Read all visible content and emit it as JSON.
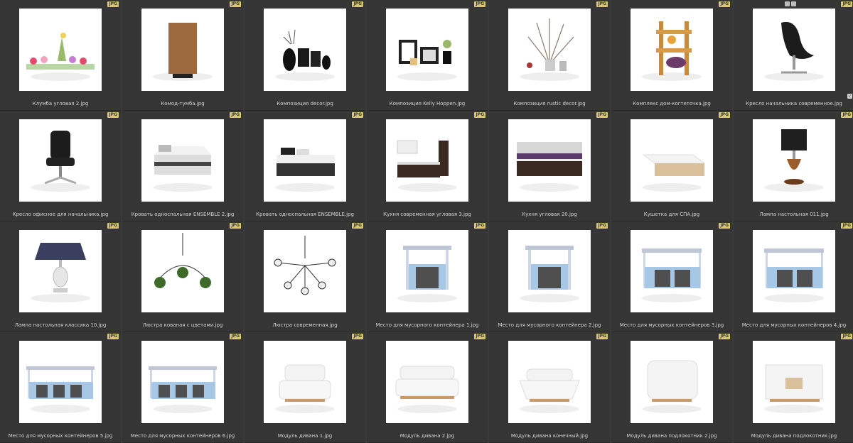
{
  "badge_text": "JPG",
  "items": [
    {
      "label": "Клумба угловая 2.jpg",
      "icon": "flowerbed"
    },
    {
      "label": "Комод-тумба.jpg",
      "icon": "cabinet"
    },
    {
      "label": "Композиция decor.jpg",
      "icon": "decor-vases"
    },
    {
      "label": "Композиция Kelly Hoppen.jpg",
      "icon": "frames"
    },
    {
      "label": "Композиция rustic decor.jpg",
      "icon": "branches"
    },
    {
      "label": "Комплекс дом-когтеточка.jpg",
      "icon": "cat-tree"
    },
    {
      "label": "Кресло начальника современное.jpg",
      "icon": "chair-modern"
    },
    {
      "label": "Кресло офисное для начальника.jpg",
      "icon": "office-chair"
    },
    {
      "label": "Кровать односпальная ENSEMBLE 2.jpg",
      "icon": "bed-white"
    },
    {
      "label": "Кровать односпальная ENSEMBLE.jpg",
      "icon": "bed-dark"
    },
    {
      "label": "Кухня современная угловая 3.jpg",
      "icon": "kitchen-corner"
    },
    {
      "label": "Кухня угловая 20.jpg",
      "icon": "kitchen-straight"
    },
    {
      "label": "Кушетка для СПА.jpg",
      "icon": "spa-couch"
    },
    {
      "label": "Лампа настольная 011.jpg",
      "icon": "table-lamp"
    },
    {
      "label": "Лампа настольная классика 10.jpg",
      "icon": "classic-lamp"
    },
    {
      "label": "Люстра кованая с цветами.jpg",
      "icon": "chandelier-flowers"
    },
    {
      "label": "Люстра современная.jpg",
      "icon": "chandelier-modern"
    },
    {
      "label": "Место для мусорного контейнера 1.jpg",
      "icon": "bin-shelter"
    },
    {
      "label": "Место для мусорного контейнера 2.jpg",
      "icon": "bin-shelter"
    },
    {
      "label": "Место для мусорных контейнеров 3.jpg",
      "icon": "bin-shelter-wide"
    },
    {
      "label": "Место для мусорных контейнеров 4.jpg",
      "icon": "bin-shelter-wide"
    },
    {
      "label": "Место для мусорных контейнеров 5.jpg",
      "icon": "bin-shelter-long"
    },
    {
      "label": "Место для мусорных контейнеров 6.jpg",
      "icon": "bin-shelter-long"
    },
    {
      "label": "Модуль дивана 1.jpg",
      "icon": "sofa-1"
    },
    {
      "label": "Модуль дивана 2.jpg",
      "icon": "sofa-2"
    },
    {
      "label": "Модуль дивана конечный.jpg",
      "icon": "sofa-end"
    },
    {
      "label": "Модуль дивана подлокотник 2.jpg",
      "icon": "sofa-arm"
    },
    {
      "label": "Модуль дивана подлокотник.jpg",
      "icon": "sofa-arm2"
    }
  ]
}
